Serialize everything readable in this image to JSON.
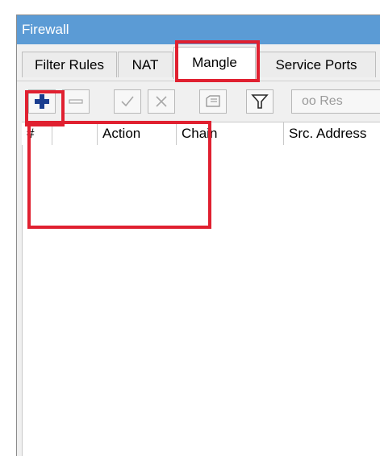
{
  "window": {
    "title": "Firewall"
  },
  "tabs": [
    {
      "label": "Filter Rules"
    },
    {
      "label": "NAT"
    },
    {
      "label": "Mangle"
    },
    {
      "label": "Service Ports"
    }
  ],
  "toolbar": {
    "add_icon": "plus-icon",
    "remove_icon": "minus-icon",
    "enable_icon": "check-icon",
    "disable_icon": "x-icon",
    "comment_icon": "comment-icon",
    "filter_icon": "filter-icon",
    "reset_label": "oo Res"
  },
  "columns": [
    {
      "label": "#"
    },
    {
      "label": ""
    },
    {
      "label": "Action"
    },
    {
      "label": "Chain"
    },
    {
      "label": "Src. Address"
    }
  ],
  "colors": {
    "titlebar": "#5b9bd5",
    "highlight": "#e02030",
    "add_icon": "#1a3d8f"
  }
}
